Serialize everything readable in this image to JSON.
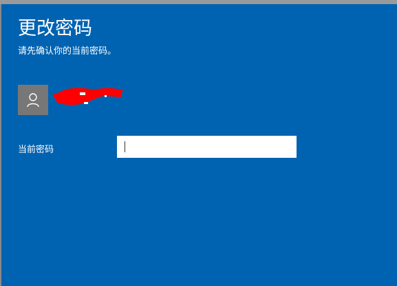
{
  "dialog": {
    "title": "更改密码",
    "subtitle": "请先确认你的当前密码。"
  },
  "account": {
    "username": "",
    "avatar_icon": "user-icon"
  },
  "password_field": {
    "label": "当前密码",
    "value": "",
    "placeholder": ""
  },
  "colors": {
    "background": "#0063b1",
    "avatar_bg": "#777777",
    "redaction": "#ff0000"
  }
}
